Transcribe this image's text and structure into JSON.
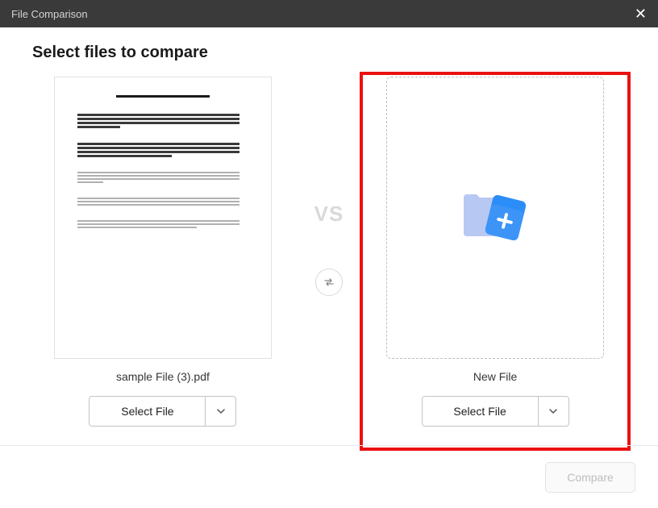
{
  "titlebar": {
    "title": "File Comparison",
    "close_glyph": "✕"
  },
  "heading": "Select files to compare",
  "middle": {
    "vs_label": "VS"
  },
  "left": {
    "file_label": "sample File (3).pdf",
    "select_label": "Select File"
  },
  "right": {
    "file_label": "New File",
    "select_label": "Select File"
  },
  "footer": {
    "compare_label": "Compare"
  }
}
